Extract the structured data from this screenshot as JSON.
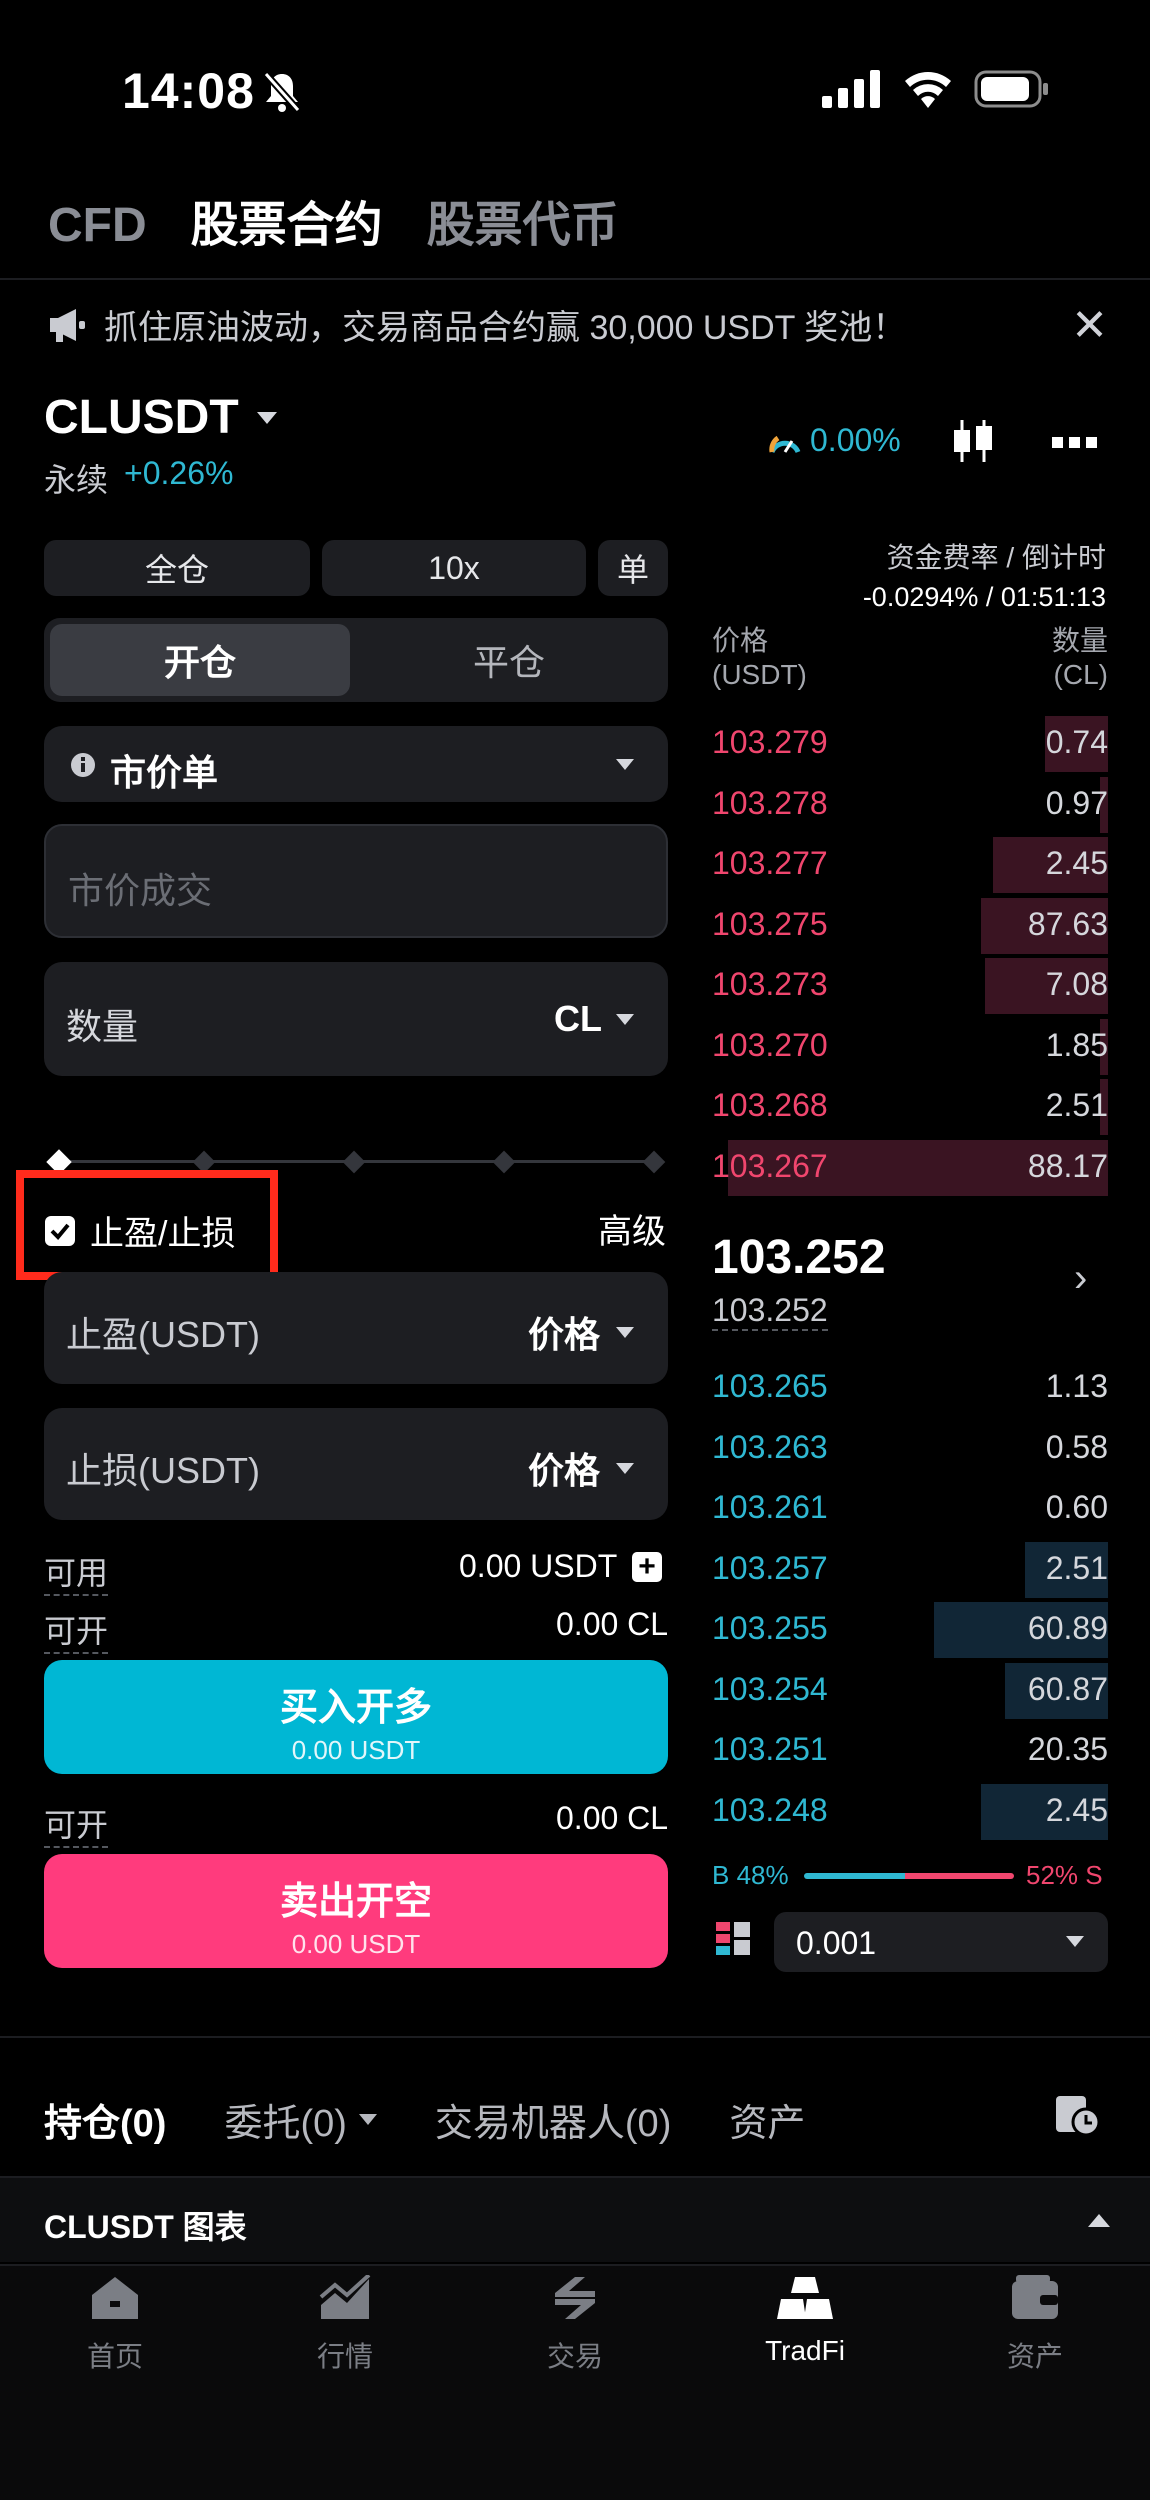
{
  "status": {
    "time": "14:08"
  },
  "top_tabs": [
    "CFD",
    "股票合约",
    "股票代币"
  ],
  "banner": {
    "text": "抓住原油波动，交易商品合约赢 30,000 USDT 奖池！"
  },
  "symbol": {
    "name": "CLUSDT",
    "type": "永续",
    "change": "+0.26%",
    "rate_indicator": "0.00%"
  },
  "margin": {
    "mode": "全仓",
    "leverage": "10x",
    "position": "单"
  },
  "open_close": {
    "open": "开仓",
    "close": "平仓"
  },
  "order_type": {
    "label": "市价单"
  },
  "price_field": {
    "placeholder": "市价成交"
  },
  "qty_field": {
    "label": "数量",
    "unit": "CL"
  },
  "slider": {
    "percent": 0
  },
  "tpsl": {
    "label": "止盈/止损",
    "checked": true,
    "advanced": "高级"
  },
  "tp_field": {
    "label": "止盈(USDT)",
    "mode": "价格"
  },
  "sl_field": {
    "label": "止损(USDT)",
    "mode": "价格"
  },
  "available": {
    "label": "可用",
    "value": "0.00 USDT"
  },
  "can_open_long": {
    "label": "可开",
    "value": "0.00 CL"
  },
  "buy": {
    "title": "买入开多",
    "sub": "0.00 USDT"
  },
  "can_open_short": {
    "label": "可开",
    "value": "0.00 CL"
  },
  "sell": {
    "title": "卖出开空",
    "sub": "0.00 USDT"
  },
  "funding": {
    "label": "资金费率 / 倒计时",
    "value": "-0.0294% / 01:51:13"
  },
  "orderbook": {
    "price_header": "价格",
    "price_unit": "(USDT)",
    "qty_header": "数量",
    "qty_unit": "(CL)",
    "asks": [
      {
        "price": "103.279",
        "qty": "0.74",
        "depth": 0.16
      },
      {
        "price": "103.278",
        "qty": "0.97",
        "depth": 0.02
      },
      {
        "price": "103.277",
        "qty": "2.45",
        "depth": 0.29
      },
      {
        "price": "103.275",
        "qty": "87.63",
        "depth": 0.32
      },
      {
        "price": "103.273",
        "qty": "7.08",
        "depth": 0.31
      },
      {
        "price": "103.270",
        "qty": "1.85",
        "depth": 0.02
      },
      {
        "price": "103.268",
        "qty": "2.51",
        "depth": 0.02
      },
      {
        "price": "103.267",
        "qty": "88.17",
        "depth": 0.96
      }
    ],
    "last_price": "103.252",
    "mark_price": "103.252",
    "bids": [
      {
        "price": "103.265",
        "qty": "1.13",
        "depth": 0
      },
      {
        "price": "103.263",
        "qty": "0.58",
        "depth": 0
      },
      {
        "price": "103.261",
        "qty": "0.60",
        "depth": 0
      },
      {
        "price": "103.257",
        "qty": "2.51",
        "depth": 0.21
      },
      {
        "price": "103.255",
        "qty": "60.89",
        "depth": 0.44
      },
      {
        "price": "103.254",
        "qty": "60.87",
        "depth": 0.26
      },
      {
        "price": "103.251",
        "qty": "20.35",
        "depth": 0
      },
      {
        "price": "103.248",
        "qty": "2.45",
        "depth": 0.32
      }
    ],
    "buy_ratio_label": "B 48%",
    "sell_ratio_label": "52% S",
    "buy_ratio": 0.48,
    "precision": "0.001"
  },
  "bottom_tabs": {
    "positions": "持仓(0)",
    "orders": "委托(0)",
    "bots": "交易机器人(0)",
    "assets": "资产"
  },
  "chart_bar": {
    "label": "CLUSDT 图表"
  },
  "nav": [
    {
      "label": "首页",
      "icon": "home-icon"
    },
    {
      "label": "行情",
      "icon": "market-icon"
    },
    {
      "label": "交易",
      "icon": "trade-icon"
    },
    {
      "label": "TradFi",
      "icon": "tradfi-icon"
    },
    {
      "label": "资产",
      "icon": "wallet-icon"
    }
  ],
  "colors": {
    "ask": "#f0466e",
    "bid": "#2fb8d2",
    "buy_button": "#00b7d4",
    "sell_button": "#ff3b7d",
    "highlight_box": "#ff2b1c"
  }
}
